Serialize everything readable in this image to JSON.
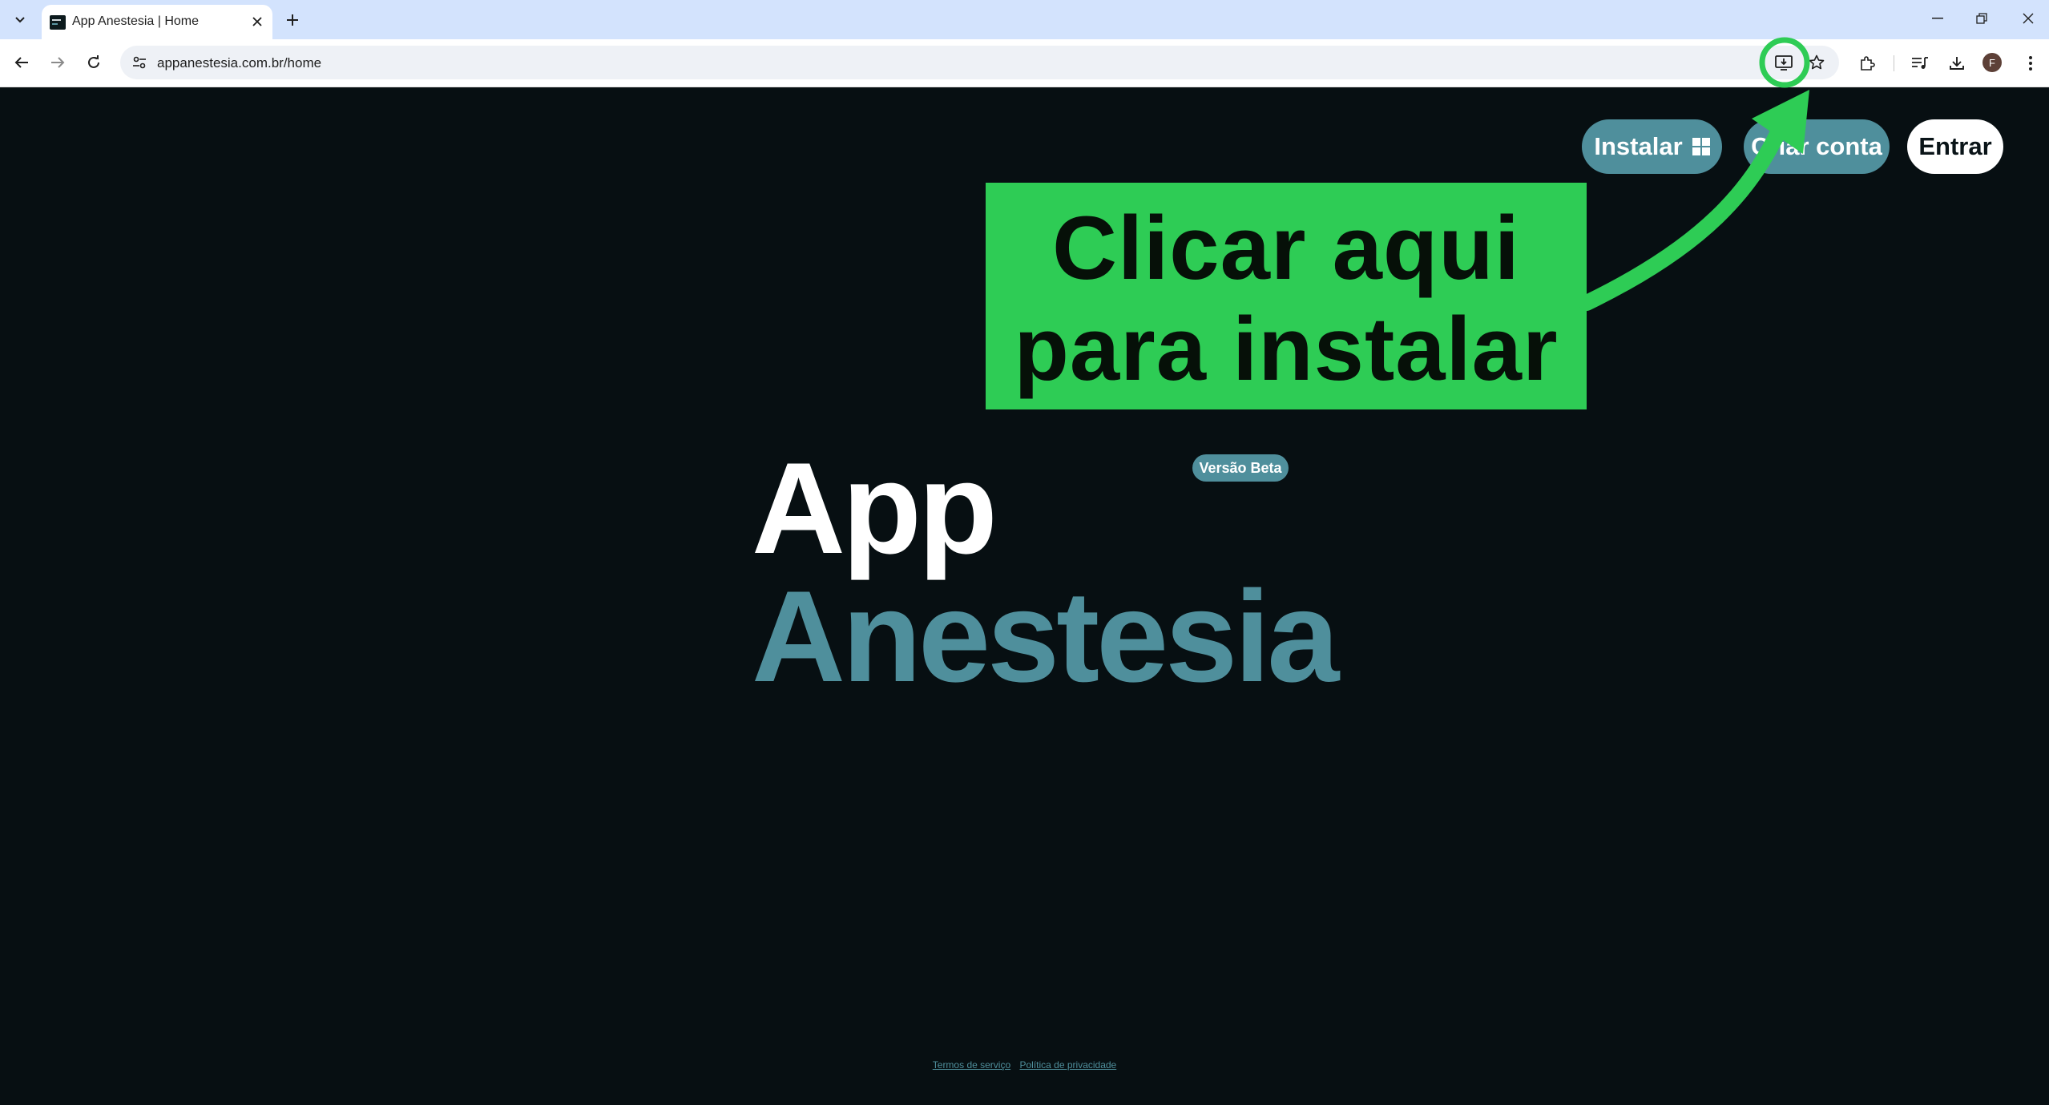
{
  "browser": {
    "tab_title": "App Anestesia | Home",
    "url": "appanestesia.com.br/home",
    "profile_initial": "F"
  },
  "header": {
    "install_label": "Instalar",
    "create_account_label": "Criar conta",
    "enter_label": "Entrar"
  },
  "hero": {
    "line1": "App",
    "line2": "Anestesia",
    "badge": "Versão Beta"
  },
  "footer": {
    "terms": "Termos de serviço",
    "privacy": "Política de privacidade"
  },
  "annotation": {
    "line1": "Clicar aqui",
    "line2": "para instalar",
    "color": "#2ecc55"
  },
  "colors": {
    "background": "#070f12",
    "accent": "#4f8f9c"
  }
}
